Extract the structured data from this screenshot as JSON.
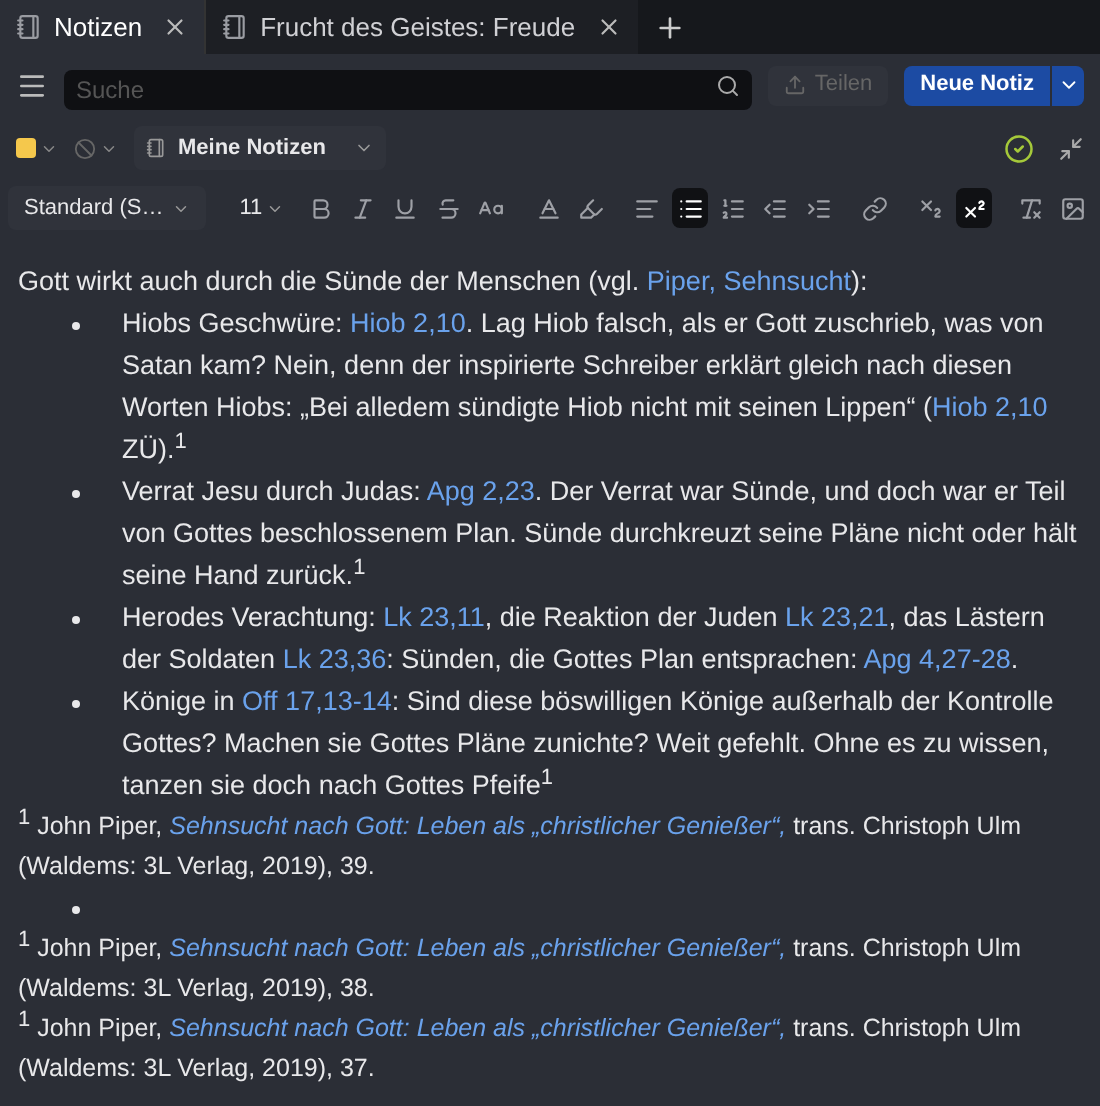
{
  "tabs": [
    {
      "label": "Notizen",
      "selected": true
    },
    {
      "label": "Frucht des Geistes: Freude",
      "selected": false
    }
  ],
  "search": {
    "placeholder": "Suche"
  },
  "share_button": {
    "label": "Teilen",
    "disabled": true
  },
  "new_note_button": {
    "label": "Neue Notiz"
  },
  "note_bar": {
    "color": "#f5c84c",
    "notebook": "Meine Notizen",
    "synced": true
  },
  "format_toolbar": {
    "style": "Standard (S…",
    "size": "11",
    "tools": [
      {
        "kind": "bold",
        "selected": false
      },
      {
        "kind": "italic",
        "selected": false
      },
      {
        "kind": "underline",
        "selected": false
      },
      {
        "kind": "strike",
        "selected": false
      },
      {
        "kind": "case",
        "selected": false
      },
      {
        "kind": "textcolor",
        "selected": false
      },
      {
        "kind": "highlight",
        "selected": false
      },
      {
        "kind": "align",
        "selected": false
      },
      {
        "kind": "bullets",
        "selected": true
      },
      {
        "kind": "numbers",
        "selected": false
      },
      {
        "kind": "outdent",
        "selected": false
      },
      {
        "kind": "indent",
        "selected": false
      },
      {
        "kind": "link",
        "selected": false
      },
      {
        "kind": "subscript",
        "selected": false
      },
      {
        "kind": "superscript",
        "selected": true
      },
      {
        "kind": "clear",
        "selected": false
      },
      {
        "kind": "image",
        "selected": false
      }
    ]
  },
  "body": [
    {
      "kind": "paragraph",
      "parts": [
        {
          "kind": "text",
          "text": "Gott wirkt auch durch die Sünde der Menschen (vgl. "
        },
        {
          "kind": "link",
          "text": "Piper, Sehnsucht"
        },
        {
          "kind": "text",
          "text": "):"
        }
      ]
    },
    {
      "kind": "bullet",
      "parts": [
        {
          "kind": "text",
          "text": "Hiobs Geschwüre: "
        },
        {
          "kind": "link",
          "text": "Hiob 2,10"
        },
        {
          "kind": "text",
          "text": ". Lag Hiob falsch, als er Gott zuschrieb, was von Satan kam? Nein, denn der inspirierte Schreiber erklärt gleich nach diesen Worten Hiobs: „Bei alledem sündigte Hiob nicht mit seinen Lippen“ ("
        },
        {
          "kind": "link",
          "text": "Hiob 2,10"
        },
        {
          "kind": "text",
          "text": " ZÜ)."
        },
        {
          "kind": "sup",
          "text": "1"
        }
      ]
    },
    {
      "kind": "bullet",
      "parts": [
        {
          "kind": "text",
          "text": "Verrat Jesu durch Judas: "
        },
        {
          "kind": "link",
          "text": "Apg 2,23"
        },
        {
          "kind": "text",
          "text": ". Der Verrat war Sünde, und doch war er Teil von Gottes beschlossenem Plan. Sünde durchkreuzt seine Pläne nicht oder hält seine Hand zurück."
        },
        {
          "kind": "sup",
          "text": "1"
        }
      ]
    },
    {
      "kind": "bullet",
      "parts": [
        {
          "kind": "text",
          "text": "Herodes Verachtung: "
        },
        {
          "kind": "link",
          "text": "Lk 23,11"
        },
        {
          "kind": "text",
          "text": ", die Reaktion der Juden "
        },
        {
          "kind": "link",
          "text": "Lk 23,21"
        },
        {
          "kind": "text",
          "text": ", das Lästern der Soldaten "
        },
        {
          "kind": "link",
          "text": "Lk 23,36"
        },
        {
          "kind": "text",
          "text": ": Sünden, die Gottes Plan entsprachen: "
        },
        {
          "kind": "link",
          "text": "Apg 4,27-28"
        },
        {
          "kind": "text",
          "text": "."
        }
      ]
    },
    {
      "kind": "bullet",
      "parts": [
        {
          "kind": "text",
          "text": "Könige in "
        },
        {
          "kind": "link",
          "text": "Off 17,13-14"
        },
        {
          "kind": "text",
          "text": ": Sind diese böswilligen Könige außerhalb der Kontrolle Gottes? Machen sie Gottes Pläne zunichte? Weit gefehlt. Ohne es zu wissen, tanzen sie doch nach Gottes Pfeife"
        },
        {
          "kind": "sup",
          "text": "1"
        }
      ]
    },
    {
      "kind": "footnote",
      "parts": [
        {
          "kind": "sup",
          "text": "1"
        },
        {
          "kind": "text",
          "text": " John Piper, "
        },
        {
          "kind": "cite",
          "text": "Sehnsucht nach Gott: Leben als „christlicher Genießer“,"
        },
        {
          "kind": "text",
          "text": " trans. Christoph Ulm (Waldems: 3L Verlag, 2019), 39."
        }
      ]
    },
    {
      "kind": "bullet"
    },
    {
      "kind": "footnote",
      "parts": [
        {
          "kind": "sup",
          "text": "1"
        },
        {
          "kind": "text",
          "text": " John Piper, "
        },
        {
          "kind": "cite",
          "text": "Sehnsucht nach Gott: Leben als „christlicher Genießer“,"
        },
        {
          "kind": "text",
          "text": " trans. Christoph Ulm (Waldems: 3L Verlag, 2019), 38."
        }
      ]
    },
    {
      "kind": "footnote",
      "parts": [
        {
          "kind": "sup",
          "text": "1"
        },
        {
          "kind": "text",
          "text": " John Piper, "
        },
        {
          "kind": "cite",
          "text": "Sehnsucht nach Gott: Leben als „christlicher Genießer“,"
        },
        {
          "kind": "text",
          "text": " trans. Christoph Ulm (Waldems: 3L Verlag, 2019), 37."
        }
      ]
    }
  ]
}
